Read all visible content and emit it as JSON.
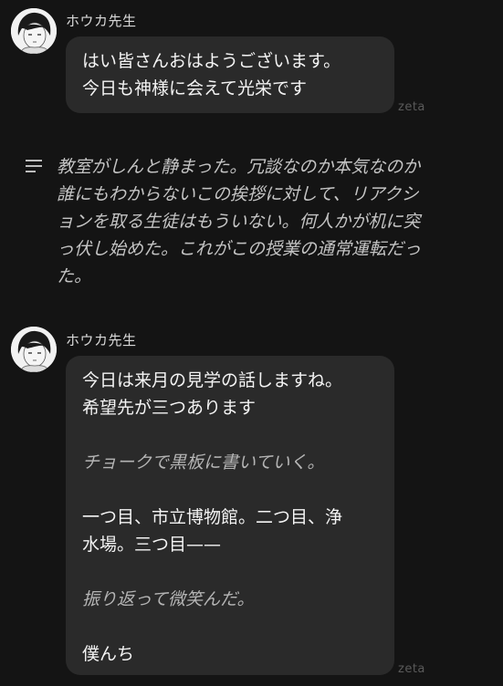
{
  "messages": [
    {
      "speaker": "ホウカ先生",
      "lines": [
        {
          "text": "はい皆さんおはようございます。",
          "kind": "speech"
        },
        {
          "text": "今日も神様に会えて光栄です",
          "kind": "speech"
        }
      ],
      "watermark": "zeta"
    },
    {
      "speaker": "ホウカ先生",
      "lines": [
        {
          "text": "今日は来月の見学の話しますね。",
          "kind": "speech"
        },
        {
          "text": "希望先が三つあります",
          "kind": "speech"
        },
        {
          "text": "チョークで黒板に書いていく。",
          "kind": "action"
        },
        {
          "text": "一つ目、市立博物館。二つ目、浄",
          "kind": "speech"
        },
        {
          "text": "水場。三つ目——",
          "kind": "speech"
        },
        {
          "text": "振り返って微笑んだ。",
          "kind": "action"
        },
        {
          "text": "僕んち",
          "kind": "speech"
        }
      ],
      "watermark": "zeta"
    }
  ],
  "narration": {
    "icon": "narration-lines-icon",
    "lines": [
      "教室がしんと静まった。冗談なのか本気なのか",
      "誰にもわからないこの挨拶に対して、リアクシ",
      "ョンを取る生徒はもういない。何人かが机に突",
      "っ伏し始めた。これがこの授業の通常運転だっ",
      "た。"
    ]
  }
}
